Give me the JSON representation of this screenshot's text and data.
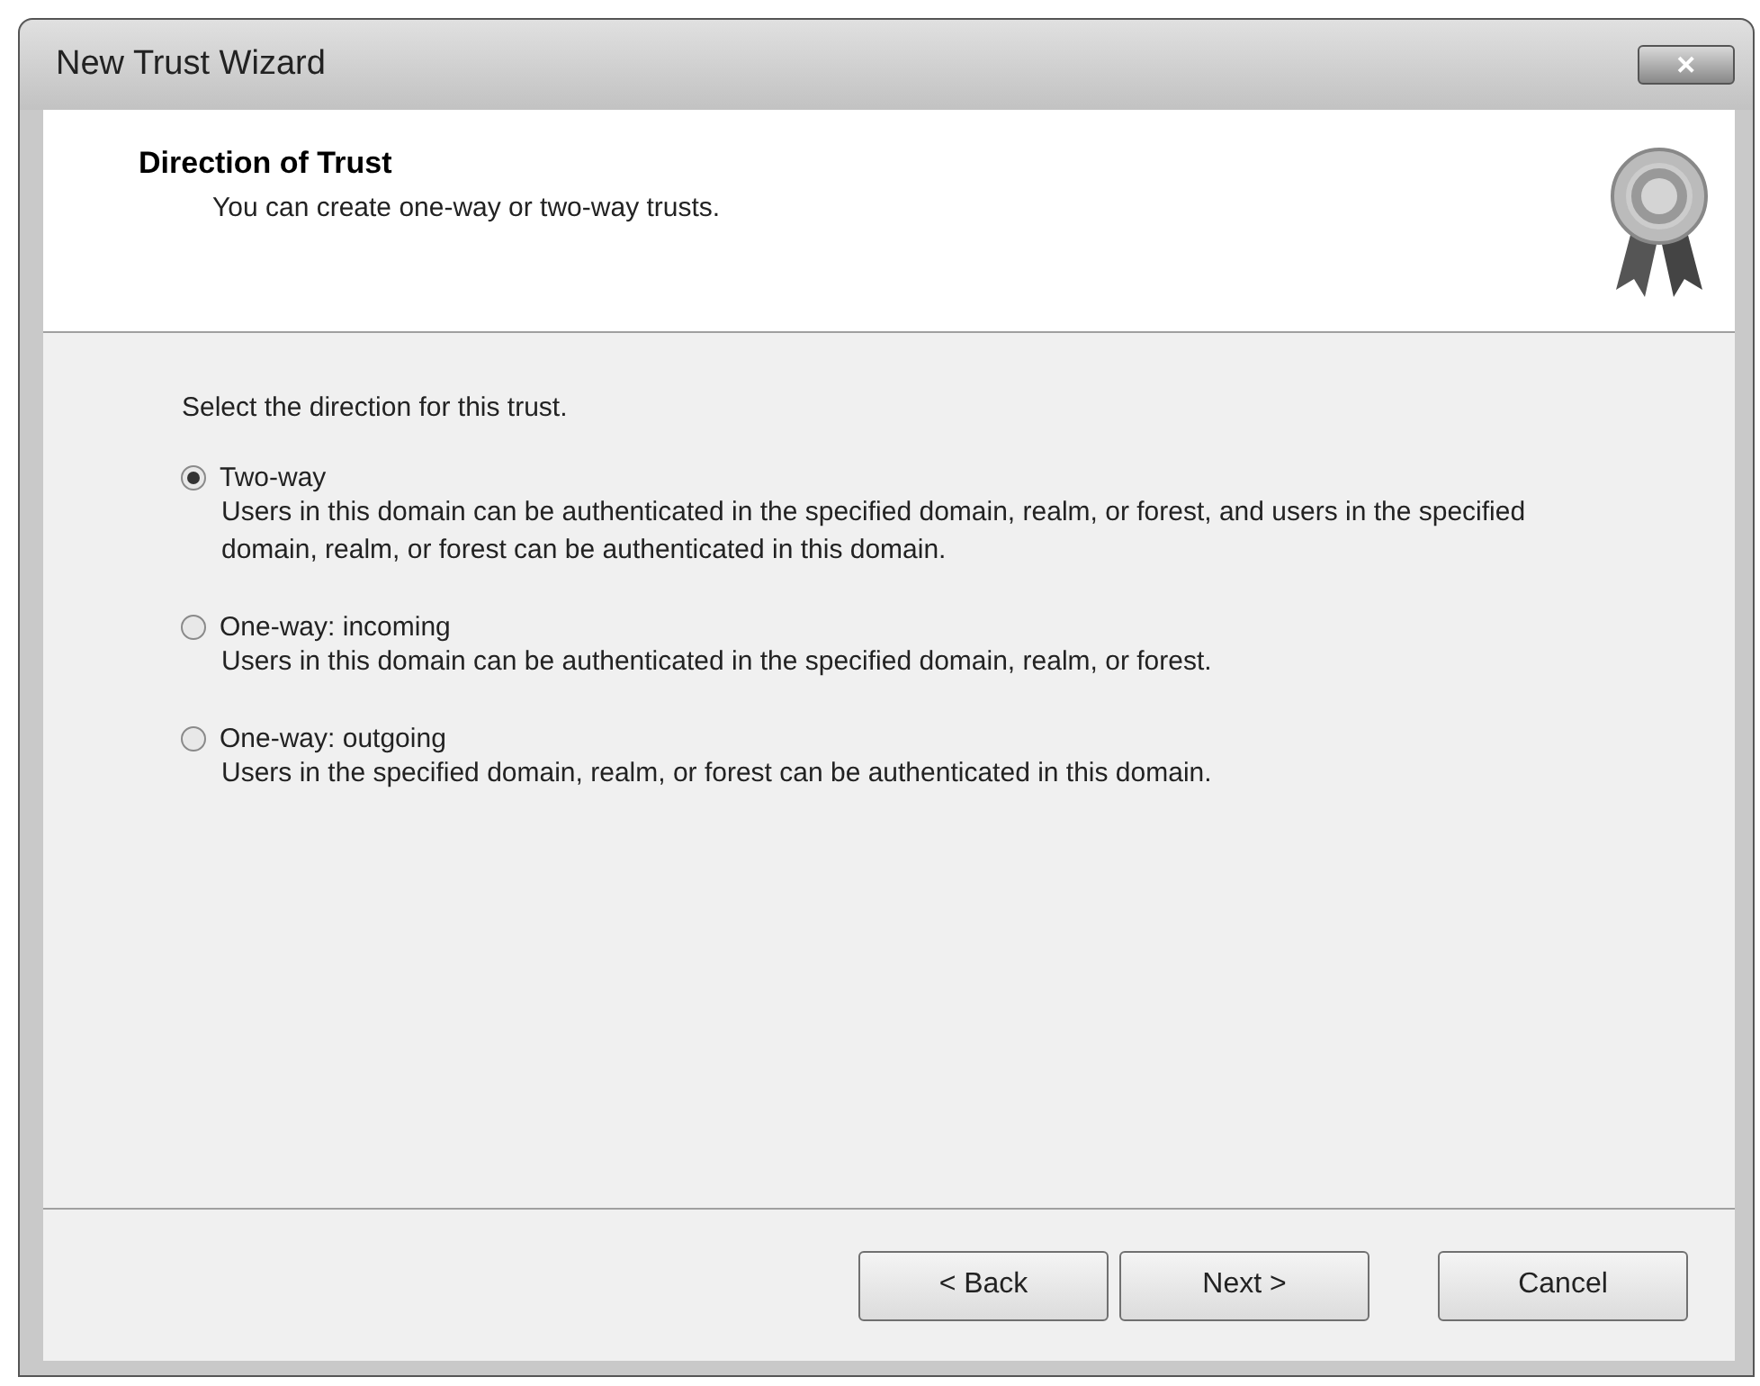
{
  "window": {
    "title": "New Trust Wizard",
    "close": "✕"
  },
  "header": {
    "title": "Direction of Trust",
    "subtitle": "You can create one-way or two-way trusts."
  },
  "prompt": "Select the direction for this trust.",
  "options": [
    {
      "label": "Two-way",
      "description": "Users in this domain can be authenticated in the specified domain, realm, or forest, and users in the specified domain, realm, or forest can be authenticated in this domain.",
      "selected": true
    },
    {
      "label": "One-way: incoming",
      "description": "Users in this domain can be authenticated in the specified domain, realm, or forest.",
      "selected": false
    },
    {
      "label": "One-way: outgoing",
      "description": "Users in the specified domain, realm, or forest can be authenticated in this domain.",
      "selected": false
    }
  ],
  "buttons": [
    "< Back",
    "Next >",
    "Cancel"
  ]
}
